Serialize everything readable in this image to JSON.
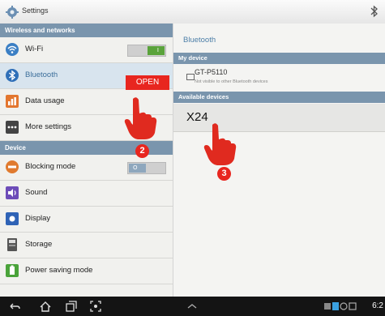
{
  "app": {
    "title": "Settings"
  },
  "sidebar": {
    "sections": [
      {
        "label": "Wireless and networks"
      },
      {
        "label": "Device"
      }
    ],
    "items": [
      {
        "label": "Wi-Fi",
        "icon": "wifi-icon",
        "toggle": "I"
      },
      {
        "label": "Bluetooth",
        "icon": "bluetooth-icon"
      },
      {
        "label": "Data usage",
        "icon": "data-usage-icon"
      },
      {
        "label": "More settings",
        "icon": "more-settings-icon"
      },
      {
        "label": "Blocking mode",
        "icon": "blocking-mode-icon",
        "toggle": "O"
      },
      {
        "label": "Sound",
        "icon": "sound-icon"
      },
      {
        "label": "Display",
        "icon": "display-icon"
      },
      {
        "label": "Storage",
        "icon": "storage-icon"
      },
      {
        "label": "Power saving mode",
        "icon": "power-saving-icon"
      }
    ]
  },
  "detail": {
    "title": "Bluetooth",
    "my_device_header": "My device",
    "my_device": {
      "name": "GT-P5110",
      "status": "Not visible to other Bluetooth devices"
    },
    "available_header": "Available devices",
    "available": [
      {
        "name": "X24"
      }
    ]
  },
  "overlay": {
    "open_label": "OPEN",
    "steps": [
      "2",
      "3"
    ]
  },
  "navbar": {
    "clock": "6:2"
  },
  "colors": {
    "accent": "#7a95ad",
    "highlight": "#e8261f",
    "link": "#4d7fa8"
  }
}
